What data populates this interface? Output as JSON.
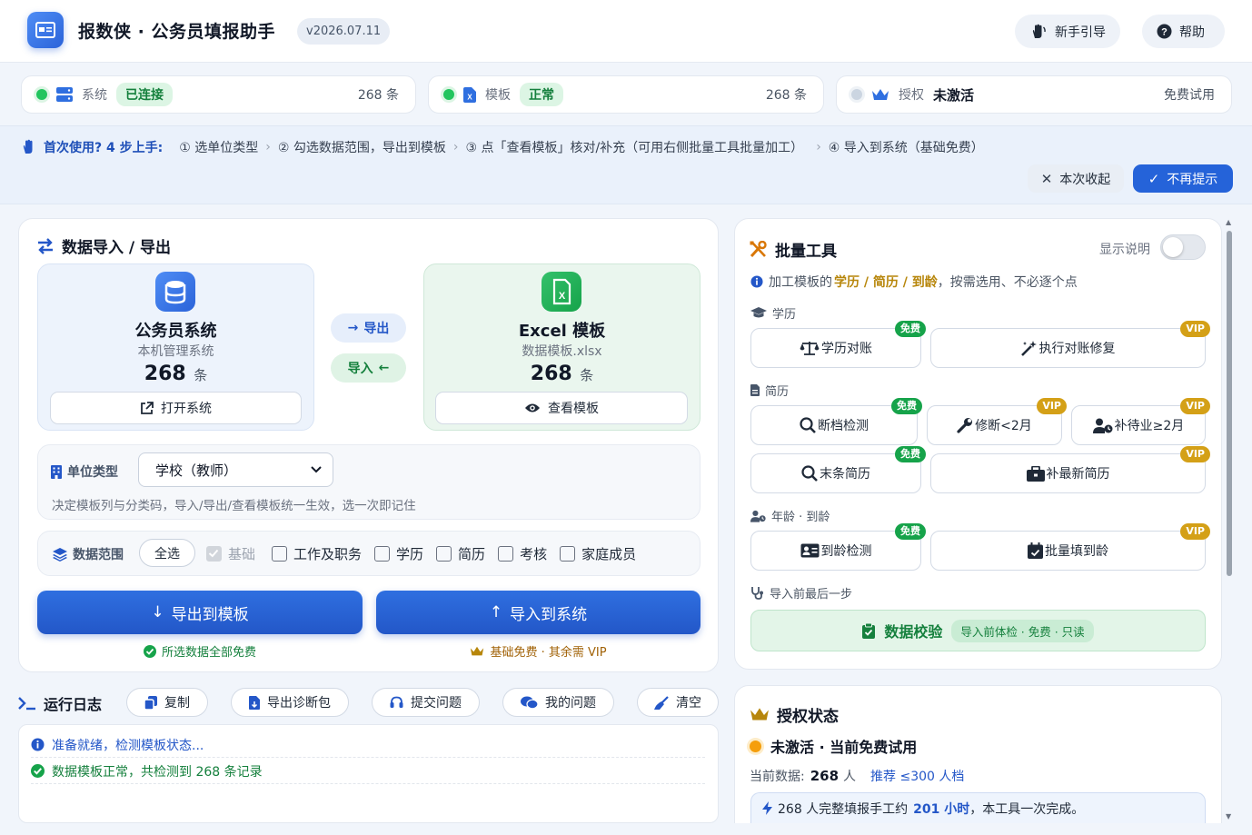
{
  "header": {
    "app_title": "报数侠 · 公务员填报助手",
    "version": "v2026.07.11",
    "guide_button": "新手引导",
    "help_button": "帮助"
  },
  "status": {
    "system": {
      "label": "系统",
      "state": "已连接",
      "count": "268 条",
      "color": "#22c55e"
    },
    "template": {
      "label": "模板",
      "state": "正常",
      "count": "268 条",
      "color": "#22c55e"
    },
    "license": {
      "label": "授权",
      "state": "未激活",
      "plan": "免费试用",
      "color": "#cbd5e1"
    }
  },
  "guide": {
    "heading": "首次使用? 4 步上手:",
    "steps": [
      "① 选单位类型",
      "② 勾选数据范围，导出到模板",
      "③ 点「查看模板」核对/补充（可用右侧批量工具批量加工）",
      "④ 导入到系统（基础免费）"
    ],
    "collapse_button": "本次收起",
    "dismiss_button": "不再提示"
  },
  "io": {
    "title": "数据导入 / 导出",
    "system": {
      "name": "公务员系统",
      "sub": "本机管理系统",
      "count": "268",
      "unit": "条",
      "button": "打开系统"
    },
    "template": {
      "name": "Excel 模板",
      "sub": "数据模板.xlsx",
      "count": "268",
      "unit": "条",
      "button": "查看模板"
    },
    "export_chip": "导出",
    "import_chip": "导入",
    "unit_type_label": "单位类型",
    "unit_type_value": "学校（教师）",
    "unit_type_hint": "决定模板列与分类码，导入/导出/查看模板统一生效，选一次即记住",
    "range_label": "数据范围",
    "select_all": "全选",
    "ranges": [
      {
        "label": "基础",
        "checked": true,
        "disabled": true
      },
      {
        "label": "工作及职务",
        "checked": false
      },
      {
        "label": "学历",
        "checked": false
      },
      {
        "label": "简历",
        "checked": false
      },
      {
        "label": "考核",
        "checked": false
      },
      {
        "label": "家庭成员",
        "checked": false
      }
    ],
    "export_button": "导出到模板",
    "import_button": "导入到系统",
    "export_note": "所选数据全部免费",
    "import_note": "基础免费 · 其余需 VIP"
  },
  "log": {
    "title": "运行日志",
    "buttons": [
      "复制",
      "导出诊断包",
      "提交问题",
      "我的问题",
      "清空"
    ],
    "entries": [
      {
        "type": "info",
        "text": "准备就绪，检测模板状态..."
      },
      {
        "type": "ok",
        "text": "数据模板正常，共检测到 268 条记录"
      }
    ]
  },
  "tools": {
    "title": "批量工具",
    "toggle_label": "显示说明",
    "hint_prefix": "加工模板的",
    "hint_emph": "学历 / 简历 / 到龄",
    "hint_suffix": "，按需选用、不必逐个点",
    "free_badge": "免费",
    "vip_badge": "VIP",
    "sections": {
      "edu": "学历",
      "resume": "简历",
      "age": "年龄 · 到龄",
      "final": "导入前最后一步"
    },
    "edu_tools": [
      "学历对账",
      "执行对账修复"
    ],
    "resume_tools": [
      "断档检测",
      "修断<2月",
      "补待业≥2月",
      "末条简历",
      "补最新简历"
    ],
    "age_tools": [
      "到龄检测",
      "批量填到龄"
    ],
    "validate_button": "数据校验",
    "validate_tag": "导入前体检 · 免费 · 只读"
  },
  "license": {
    "title": "授权状态",
    "state": "未激活 · 当前免费试用",
    "data_label": "当前数据:",
    "data_count": "268",
    "data_unit": "人",
    "recommend": "推荐 ≤300 人档",
    "promo_prefix": "268 人完整填报手工约",
    "promo_hours": "201 小时",
    "promo_suffix": "，本工具一次完成。"
  }
}
